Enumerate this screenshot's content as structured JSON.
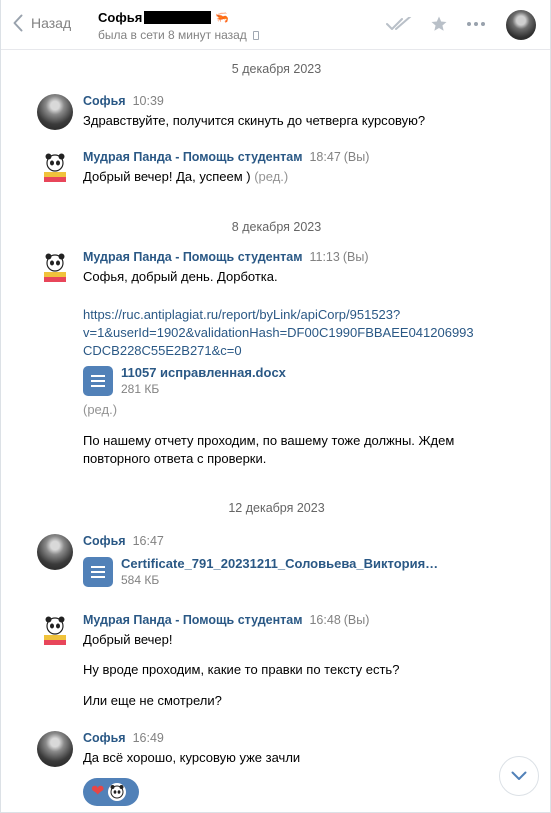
{
  "header": {
    "back_label": "Назад",
    "peer_name": "Софья",
    "peer_emoji": "🦐",
    "status": "была в сети 8 минут назад"
  },
  "colors": {
    "accent": "#5181b8",
    "link": "#2a5885",
    "muted": "#828282"
  },
  "dates": [
    "5 декабря 2023",
    "8 декабря 2023",
    "12 декабря 2023"
  ],
  "messages": [
    {
      "author": "Софья",
      "time": "10:39",
      "text": "Здравствуйте, получится скинуть до четверга курсовую?"
    },
    {
      "author": "Мудрая Панда - Помощь студентам",
      "time": "18:47",
      "you": "(Вы)",
      "text": "Добрый вечер! Да, успеем )",
      "edited": "(ред.)"
    },
    {
      "author": "Мудрая Панда - Помощь студентам",
      "time": "11:13",
      "you": "(Вы)",
      "text1": "Софья, добрый день. Дорботка.",
      "link_lines": [
        "https://ruc.antiplagiat.ru/report/byLink/apiCorp/951523?",
        "v=1&userId=1902&validationHash=DF00C1990FBBAEE041206993",
        "CDCB228C55E2B271&c=0"
      ],
      "doc_name": "11057 исправленная.docx",
      "doc_size": "281 КБ",
      "edited": "(ред.)",
      "text2_lines": [
        "По нашему отчету проходим, по вашему тоже должны. Ждем",
        "повторного ответа с проверки."
      ]
    },
    {
      "author": "Софья",
      "time": "16:47",
      "doc_name": "Certificate_791_20231211_Соловьева_Виктория_Ев...",
      "doc_size": "584 КБ"
    },
    {
      "author": "Мудрая Панда - Помощь студентам",
      "time": "16:48",
      "you": "(Вы)",
      "line1": "Добрый вечер!",
      "line2": "Ну вроде проходим, какие то правки по тексту есть?",
      "line3": "Или еще не смотрели?"
    },
    {
      "author": "Софья",
      "time": "16:49",
      "text": "Да всё хорошо, курсовую уже зачли",
      "reaction": "❤"
    }
  ]
}
